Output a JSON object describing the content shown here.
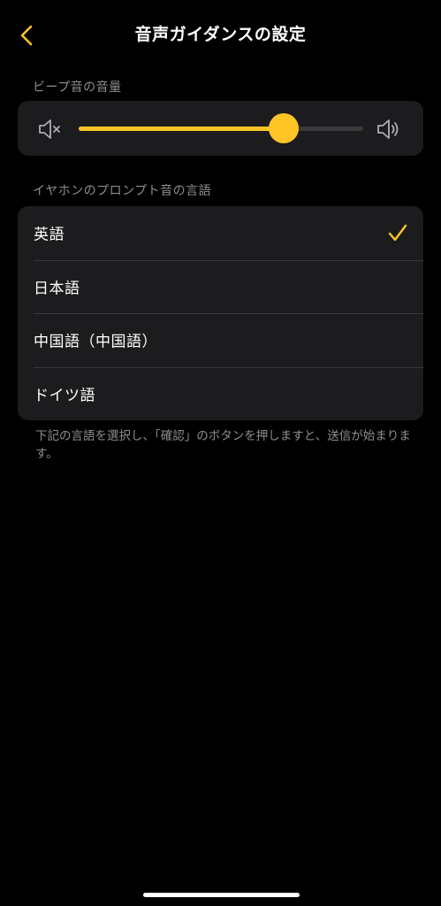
{
  "colors": {
    "accent": "#ffc426",
    "background": "#000000",
    "card": "#1c1c1e",
    "secondary_text": "#8e8e93"
  },
  "nav": {
    "title": "音声ガイダンスの設定",
    "back_icon": "chevron-left-icon"
  },
  "volume": {
    "header": "ビープ音の音量",
    "level_fraction": 0.72,
    "mute_icon": "speaker-mute-icon",
    "loud_icon": "speaker-loud-icon"
  },
  "language": {
    "header": "イヤホンのプロンプト音の言語",
    "selected_index": 0,
    "options": [
      {
        "label": "英語",
        "selected": true
      },
      {
        "label": "日本語",
        "selected": false
      },
      {
        "label": "中国語（中国語）",
        "selected": false
      },
      {
        "label": "ドイツ語",
        "selected": false
      }
    ]
  },
  "footer_note": "下記の言語を選択し、「確認」のボタンを押しますと、送信が始まります。"
}
